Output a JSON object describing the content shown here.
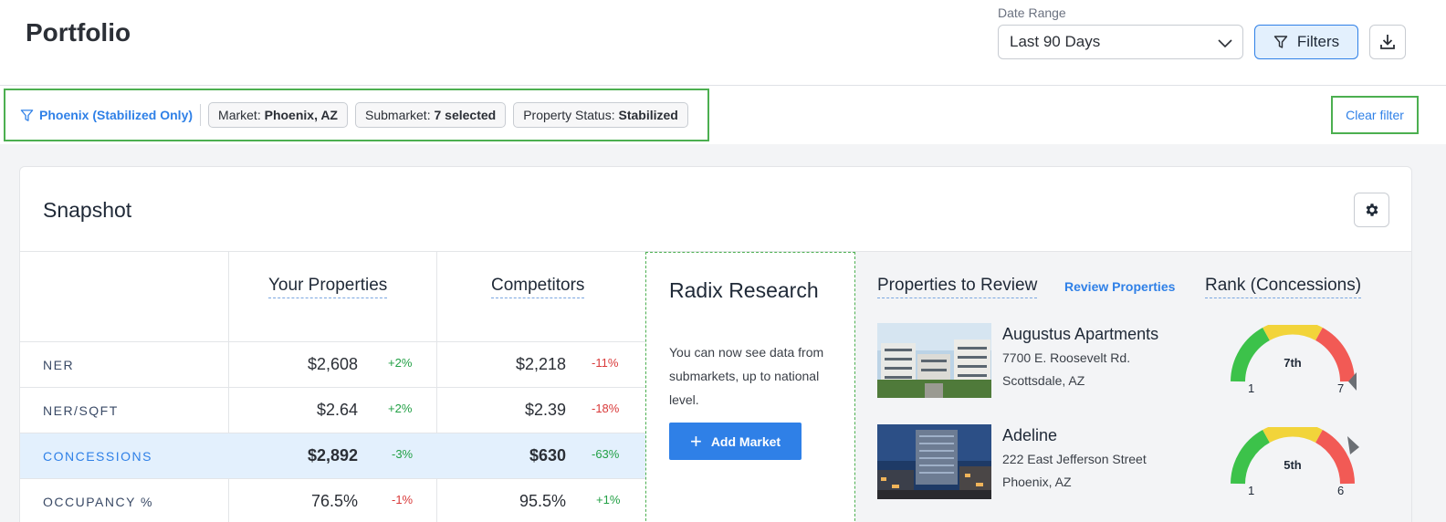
{
  "header": {
    "title": "Portfolio",
    "date_range_label": "Date Range",
    "date_range_value": "Last 90 Days",
    "filters_label": "Filters"
  },
  "filter_bar": {
    "saved_filter": "Phoenix (Stabilized Only)",
    "chips": [
      {
        "key": "Market:",
        "value": "Phoenix, AZ"
      },
      {
        "key": "Submarket:",
        "value": "7 selected"
      },
      {
        "key": "Property Status:",
        "value": "Stabilized"
      }
    ],
    "clear_label": "Clear filter"
  },
  "snapshot": {
    "title": "Snapshot",
    "col_your": "Your Properties",
    "col_comp": "Competitors",
    "rows": [
      {
        "label": "NER",
        "your": "$2,608",
        "your_chg": "+2%",
        "comp": "$2,218",
        "comp_chg": "-11%"
      },
      {
        "label": "NER/SQFT",
        "your": "$2.64",
        "your_chg": "+2%",
        "comp": "$2.39",
        "comp_chg": "-18%"
      },
      {
        "label": "CONCESSIONS",
        "your": "$2,892",
        "your_chg": "-3%",
        "comp": "$630",
        "comp_chg": "-63%"
      },
      {
        "label": "OCCUPANCY %",
        "your": "76.5%",
        "your_chg": "-1%",
        "comp": "95.5%",
        "comp_chg": "+1%"
      }
    ]
  },
  "radix": {
    "title": "Radix Research",
    "text": "You can now see data from submarkets, up to national level.",
    "button_label": "Add Market"
  },
  "review": {
    "title": "Properties to Review",
    "link_label": "Review Properties",
    "rank_title": "Rank (Concessions)",
    "properties": [
      {
        "name": "Augustus Apartments",
        "address1": "7700 E. Roosevelt Rd.",
        "address2": "Scottsdale, AZ",
        "rank": "7th",
        "min": "1",
        "max": "7"
      },
      {
        "name": "Adeline",
        "address1": "222 East Jefferson Street",
        "address2": "Phoenix, AZ",
        "rank": "5th",
        "min": "1",
        "max": "6"
      }
    ]
  },
  "colors": {
    "accent": "#2f80e7",
    "highlight_border": "#4caf50",
    "positive": "#22a045",
    "negative": "#d93a3a",
    "gauge_green": "#3cc24a",
    "gauge_yellow": "#f2d43a",
    "gauge_red": "#f25a55"
  },
  "icons": {
    "filter": "filter-funnel-icon",
    "download": "download-icon",
    "settings": "gear-icon",
    "dropdown": "chevron-down-icon"
  }
}
